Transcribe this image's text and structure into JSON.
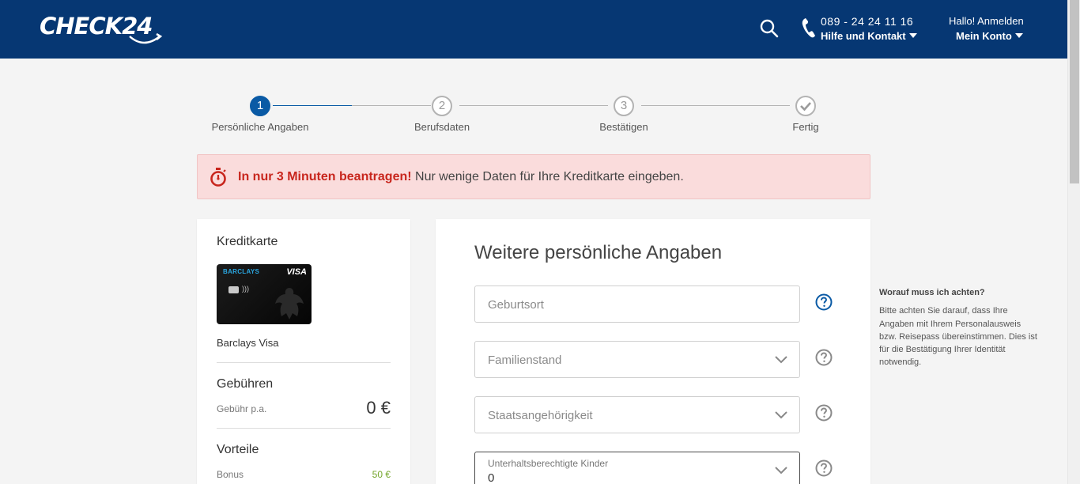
{
  "header": {
    "logo": "CHECK24",
    "phone": "089 - 24 24 11 16",
    "help_label": "Hilfe und Kontakt",
    "hello": "Hallo! Anmelden",
    "account_label": "Mein Konto",
    "background_color": "#063773"
  },
  "stepper": {
    "steps": [
      {
        "number": "1",
        "label": "Persönliche Angaben",
        "state": "active"
      },
      {
        "number": "2",
        "label": "Berufsdaten",
        "state": "pending"
      },
      {
        "number": "3",
        "label": "Bestätigen",
        "state": "pending"
      },
      {
        "number": "check-icon",
        "label": "Fertig",
        "state": "pending"
      }
    ],
    "accent_color": "#0a5aa5"
  },
  "alert": {
    "strong": "In nur 3 Minuten beantragen!",
    "text": "Nur wenige Daten für Ihre Kreditkarte eingeben.",
    "icon": "stopwatch-icon",
    "accent_color": "#c8261d"
  },
  "sidebar": {
    "card_title": "Kreditkarte",
    "card_brand": "BARCLAYS",
    "card_network": "VISA",
    "card_name": "Barclays Visa",
    "fees_title": "Gebühren",
    "fee_label": "Gebühr p.a.",
    "fee_value": "0 €",
    "benefits_title": "Vorteile",
    "bonus_label": "Bonus",
    "bonus_value": "50 €",
    "bonus_color": "#74a52a"
  },
  "form": {
    "title": "Weitere persönliche Angaben",
    "fields": [
      {
        "placeholder": "Geburtsort",
        "type": "text"
      },
      {
        "placeholder": "Familienstand",
        "type": "select"
      },
      {
        "placeholder": "Staatsangehörigkeit",
        "type": "select"
      },
      {
        "label": "Unterhaltsberechtigte Kinder",
        "value": "0",
        "type": "select"
      }
    ]
  },
  "tooltip": {
    "title": "Worauf muss ich achten?",
    "text": "Bitte achten Sie darauf, dass Ihre Angaben mit Ihrem Personalausweis bzw. Reisepass übereinstimmen. Dies ist für die Bestätigung Ihrer Identität notwendig."
  }
}
